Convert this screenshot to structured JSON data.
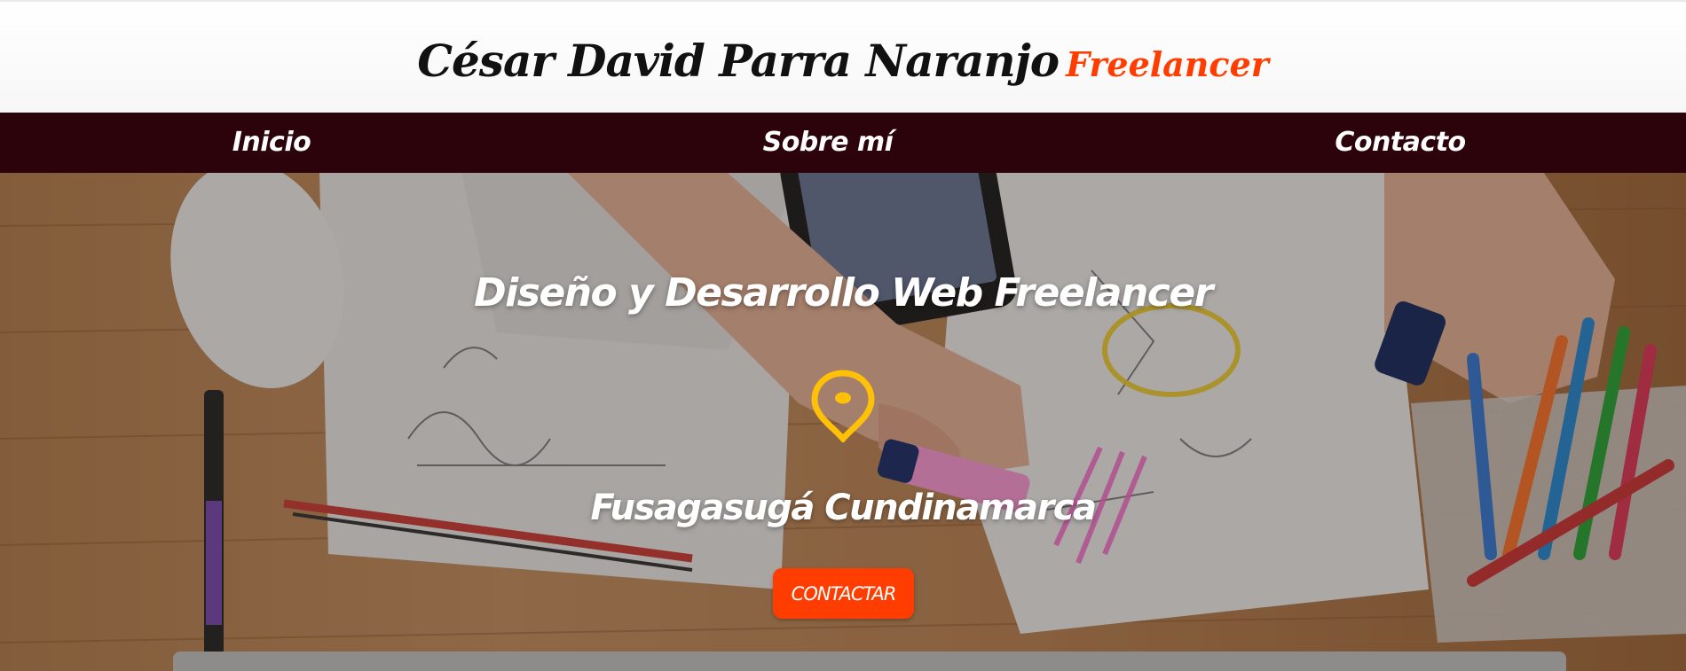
{
  "header": {
    "title": "César David Parra Naranjo",
    "title_accent": "Freelancer"
  },
  "nav": {
    "items": [
      {
        "label": "Inicio"
      },
      {
        "label": "Sobre mí"
      },
      {
        "label": "Contacto"
      }
    ]
  },
  "hero": {
    "headline": "Diseño y Desarrollo Web Freelancer",
    "location_icon": "map-pin-icon",
    "location": "Fusagasugá Cundinamarca",
    "cta_label": "CONTACTAR"
  },
  "colors": {
    "accent": "#ff3d00",
    "nav_background": "#2c020b",
    "icon": "#ffc107"
  }
}
